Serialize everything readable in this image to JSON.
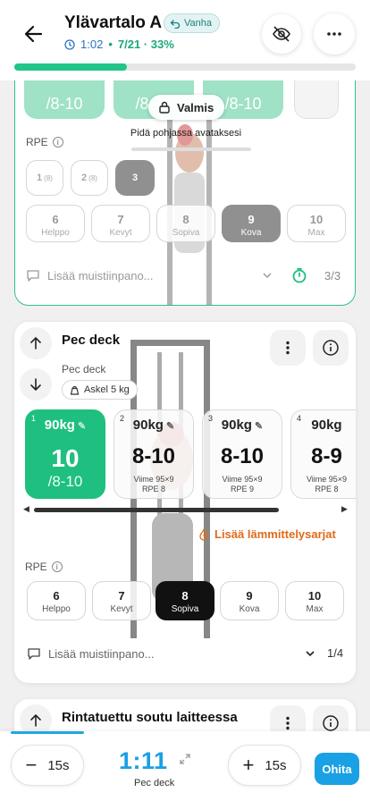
{
  "header": {
    "title": "Ylävartalo A",
    "badge": "Vanha",
    "elapsed": "1:02",
    "progress_text": "7/21 · 33%",
    "progress_fraction": 0.33
  },
  "prev_exercise": {
    "set_targets": [
      "/8-10",
      "/8-10",
      "/8-10"
    ],
    "valmis_label": "Valmis",
    "hold_text": "Pidä pohjassa avataksesi",
    "rpe_label": "RPE",
    "rpe_small": [
      {
        "n": "1",
        "sup": "(8)"
      },
      {
        "n": "2",
        "sup": "(8)"
      },
      {
        "n": "3",
        "sup": ""
      }
    ],
    "rpe_options": [
      {
        "n": "6",
        "t": "Helppo"
      },
      {
        "n": "7",
        "t": "Kevyt"
      },
      {
        "n": "8",
        "t": "Sopiva"
      },
      {
        "n": "9",
        "t": "Kova"
      },
      {
        "n": "10",
        "t": "Max"
      }
    ],
    "note_placeholder": "Lisää muistiinpano...",
    "sets_count": "3/3"
  },
  "pec_deck": {
    "title": "Pec deck",
    "subtitle": "Pec deck",
    "step": "Askel 5 kg",
    "sets": [
      {
        "idx": "1",
        "weight": "90kg",
        "big": "10",
        "target": "/8-10",
        "prev1": "",
        "prev2": ""
      },
      {
        "idx": "2",
        "weight": "90kg",
        "big": "8-10",
        "target": "",
        "prev1": "Viime 95×9",
        "prev2": "RPE 8"
      },
      {
        "idx": "3",
        "weight": "90kg",
        "big": "8-10",
        "target": "",
        "prev1": "Viime 95×9",
        "prev2": "RPE 9"
      },
      {
        "idx": "4",
        "weight": "90kg",
        "big": "8-9",
        "target": "",
        "prev1": "Viime 95×9",
        "prev2": "RPE 8"
      }
    ],
    "warmup_label": "Lisää lämmittelysarjat",
    "rpe_label": "RPE",
    "rpe_options": [
      {
        "n": "6",
        "t": "Helppo"
      },
      {
        "n": "7",
        "t": "Kevyt"
      },
      {
        "n": "8",
        "t": "Sopiva"
      },
      {
        "n": "9",
        "t": "Kova"
      },
      {
        "n": "10",
        "t": "Max"
      }
    ],
    "note_placeholder": "Lisää muistiinpano...",
    "sets_count": "1/4"
  },
  "next_exercise": {
    "title": "Rintatuettu soutu laitteessa"
  },
  "timer": {
    "minus_label": "15s",
    "plus_label": "15s",
    "value": "1:11",
    "exercise": "Pec deck",
    "skip_label": "Ohita"
  },
  "colors": {
    "accent_green": "#1fbf7f",
    "accent_blue": "#1aa0e4",
    "warm_orange": "#e06a1b"
  }
}
